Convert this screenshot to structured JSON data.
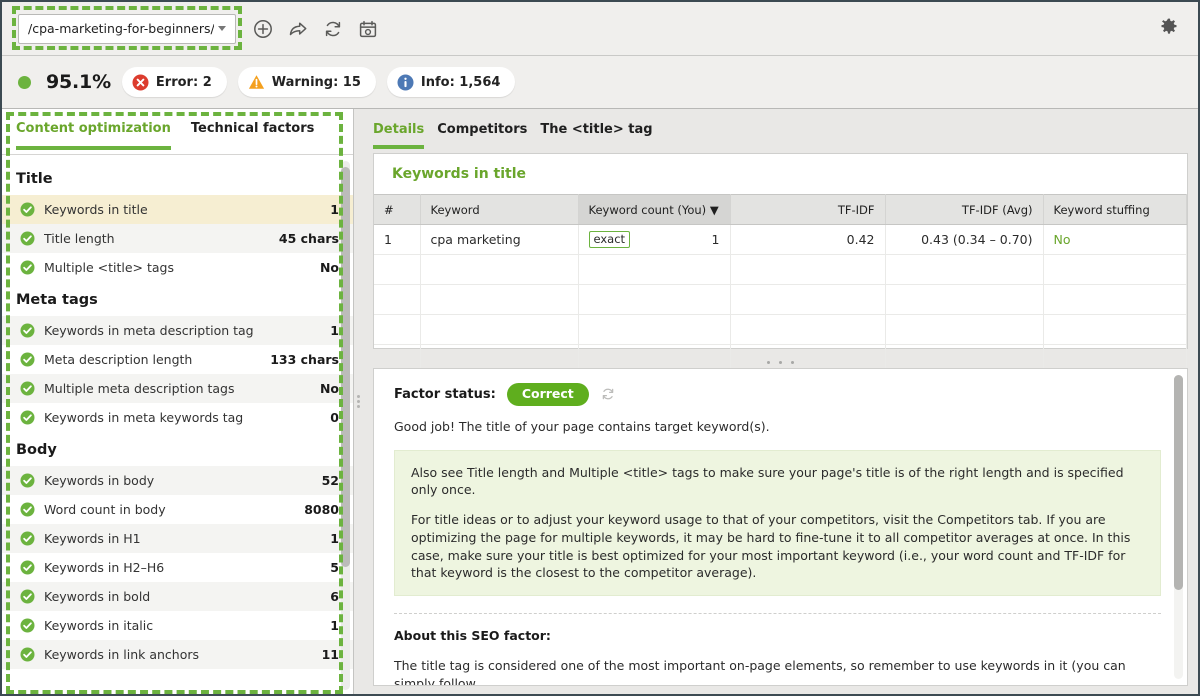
{
  "toolbar": {
    "url_value": "/cpa-marketing-for-beginners/",
    "icons": [
      {
        "name": "add-circle-icon",
        "title": "Add page"
      },
      {
        "name": "share-arrow-icon",
        "title": "Share"
      },
      {
        "name": "refresh-icon",
        "title": "Rebuild"
      },
      {
        "name": "schedule-calendar-icon",
        "title": "Schedule"
      }
    ],
    "settings_title": "Settings"
  },
  "status": {
    "score": "95.1%",
    "badges": [
      {
        "icon": "error-icon",
        "label": "Error: 2",
        "color": "#dc3c2e"
      },
      {
        "icon": "warning-icon",
        "label": "Warning: 15",
        "color": "#f4a01e"
      },
      {
        "icon": "info-icon",
        "label": "Info: 1,564",
        "color": "#4d79b5"
      }
    ]
  },
  "sidebar": {
    "tabs": [
      {
        "label": "Content optimization",
        "active": true
      },
      {
        "label": "Technical factors",
        "active": false
      }
    ],
    "groups": [
      {
        "title": "Title",
        "items": [
          {
            "label": "Keywords in title",
            "value": "1",
            "status": "ok",
            "selected": true
          },
          {
            "label": "Title length",
            "value": "45 chars",
            "status": "ok",
            "selected": false
          },
          {
            "label": "Multiple <title> tags",
            "value": "No",
            "status": "ok",
            "selected": false
          }
        ]
      },
      {
        "title": "Meta tags",
        "items": [
          {
            "label": "Keywords in meta description tag",
            "value": "1",
            "status": "ok",
            "selected": false
          },
          {
            "label": "Meta description length",
            "value": "133 chars",
            "status": "ok",
            "selected": false
          },
          {
            "label": "Multiple meta description tags",
            "value": "No",
            "status": "ok",
            "selected": false
          },
          {
            "label": "Keywords in meta keywords tag",
            "value": "0",
            "status": "ok",
            "selected": false
          }
        ]
      },
      {
        "title": "Body",
        "items": [
          {
            "label": "Keywords in body",
            "value": "52",
            "status": "ok",
            "selected": false
          },
          {
            "label": "Word count in body",
            "value": "8080",
            "status": "ok",
            "selected": false
          },
          {
            "label": "Keywords in H1",
            "value": "1",
            "status": "ok",
            "selected": false
          },
          {
            "label": "Keywords in H2–H6",
            "value": "5",
            "status": "ok",
            "selected": false
          },
          {
            "label": "Keywords in bold",
            "value": "6",
            "status": "ok",
            "selected": false
          },
          {
            "label": "Keywords in italic",
            "value": "1",
            "status": "ok",
            "selected": false
          },
          {
            "label": "Keywords in link anchors",
            "value": "11",
            "status": "ok",
            "selected": false
          }
        ]
      }
    ]
  },
  "main": {
    "tabs": [
      {
        "label": "Details",
        "active": true
      },
      {
        "label": "Competitors",
        "active": false
      },
      {
        "label": "The <title> tag",
        "active": false
      }
    ],
    "card_title": "Keywords in title",
    "table": {
      "columns": [
        {
          "label": "#",
          "align": "left"
        },
        {
          "label": "Keyword",
          "align": "left"
        },
        {
          "label": "Keyword count (You)",
          "align": "left",
          "sorted": true,
          "sort_dir": "desc"
        },
        {
          "label": "TF-IDF",
          "align": "right"
        },
        {
          "label": "TF-IDF (Avg)",
          "align": "right"
        },
        {
          "label": "Keyword stuffing",
          "align": "left"
        }
      ],
      "rows": [
        {
          "index": "1",
          "keyword": "cpa marketing",
          "match_badge": "exact",
          "keyword_count": "1",
          "tfidf": "0.42",
          "tfidf_avg": "0.43 (0.34 – 0.70)",
          "stuffing": "No"
        }
      ],
      "empty_rows": 4
    },
    "detail": {
      "factor_status_label": "Factor status:",
      "factor_status_value": "Correct",
      "recheck_icon": "refresh-icon",
      "summary": "Good job! The title of your page contains target keyword(s).",
      "tips": [
        "Also see Title length and Multiple <title> tags to make sure your page's title is of the right length and is specified only once.",
        "For title ideas or to adjust your keyword usage to that of your competitors, visit the Competitors tab. If you are optimizing the page for multiple keywords, it may be hard to fine-tune it to all competitor averages at once. In this case, make sure your title is best optimized for your most important keyword (i.e., your word count and TF-IDF for that keyword is the closest to the competitor average)."
      ],
      "about_heading": "About this SEO factor:",
      "about_text": "The title tag is considered one of the most important on-page elements, so remember to use keywords in it (you can simply follow"
    }
  }
}
